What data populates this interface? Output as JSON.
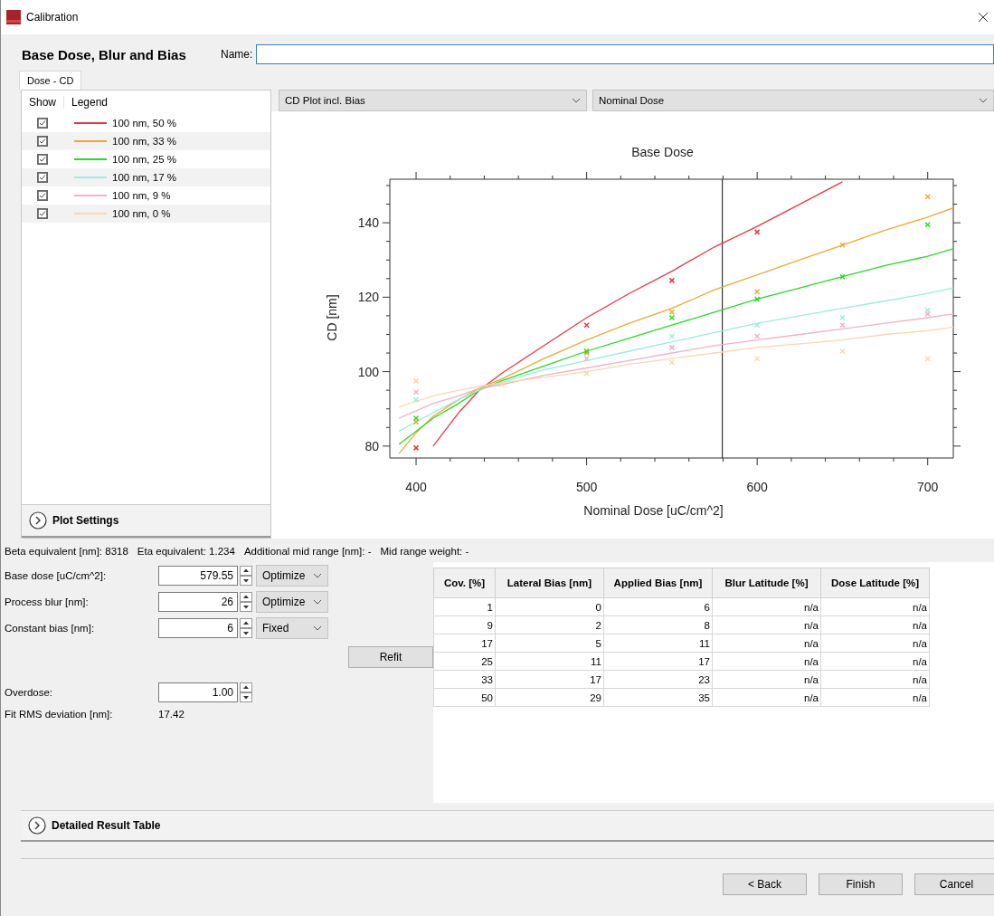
{
  "window": {
    "title": "Calibration"
  },
  "heading": "Base Dose, Blur and Bias",
  "name_field": {
    "label": "Name:"
  },
  "tabs": [
    {
      "label": "Dose - CD",
      "selected": true
    }
  ],
  "legend": {
    "columns": [
      "Show",
      "Legend"
    ],
    "items": [
      {
        "show": true,
        "label": "100 nm, 50 %",
        "color": "#ee3344"
      },
      {
        "show": true,
        "label": "100 nm, 33 %",
        "color": "#f0a830"
      },
      {
        "show": true,
        "label": "100 nm, 25 %",
        "color": "#22dd22"
      },
      {
        "show": true,
        "label": "100 nm, 17 %",
        "color": "#99eedd"
      },
      {
        "show": true,
        "label": "100 nm, 9 %",
        "color": "#f4b0c8"
      },
      {
        "show": true,
        "label": "100 nm, 0 %",
        "color": "#f8d8b0"
      }
    ]
  },
  "plot_settings": {
    "label": "Plot Settings",
    "expanded": false
  },
  "plot_type": {
    "value": "CD Plot incl. Bias"
  },
  "x_axis": {
    "value": "Nominal Dose"
  },
  "plot": {
    "fit_curves": {
      "chart_data": {
        "type": "line",
        "title": "Base Dose",
        "xlabel": "Nominal Dose [uC/cm^2]",
        "ylabel": "CD [nm]",
        "x": [
          390,
          400,
          410,
          425,
          437,
          450,
          475,
          500,
          525,
          550,
          575,
          600,
          625,
          650,
          675,
          700,
          715
        ],
        "xlim": [
          384.6,
          715
        ],
        "ylim": [
          76.8,
          151.7
        ],
        "xticks": [
          400,
          500,
          600,
          700
        ],
        "yticks": [
          80,
          100,
          120,
          140
        ],
        "series": [
          {
            "color": "#ee3344",
            "values": [
              null,
              null,
              80,
              89,
              95,
              99.5,
              107,
              114.5,
              121,
              127,
              133.5,
              139,
              145,
              151,
              null,
              null,
              null
            ]
          },
          {
            "color": "#f0a830",
            "values": [
              78,
              83.5,
              88,
              92.5,
              95.5,
              98,
              103.5,
              108.5,
              113,
              117,
              122,
              126,
              130,
              134,
              138,
              141.5,
              144
            ]
          },
          {
            "color": "#22dd22",
            "values": [
              80.5,
              84,
              87.5,
              91.5,
              95,
              97.5,
              101.5,
              105.5,
              109,
              112.5,
              116,
              119.5,
              122.5,
              125.5,
              128.5,
              131,
              133
            ]
          },
          {
            "color": "#99eedd",
            "values": [
              84,
              86.5,
              89,
              92.5,
              95,
              97,
              100.5,
              103,
              105.5,
              108,
              110.5,
              113,
              115,
              117,
              119,
              121,
              122.5
            ]
          },
          {
            "color": "#f4b0c8",
            "values": [
              87.5,
              89.5,
              91.5,
              93.5,
              95.5,
              96.5,
              99,
              101,
              103,
              105,
              107,
              108.5,
              110,
              111.5,
              113,
              114.5,
              115.5
            ]
          },
          {
            "color": "#f8d8b0",
            "values": [
              90.5,
              92,
              93.5,
              95,
              96,
              97,
              98.5,
              100,
              102,
              103.5,
              105,
              106.5,
              107.5,
              108.5,
              110,
              111,
              112
            ]
          }
        ]
      }
    },
    "measurements": {
      "chart_data": {
        "type": "scatter",
        "x": [
          400,
          450,
          500,
          550,
          600,
          650,
          700
        ],
        "xlim": [
          384.6,
          715
        ],
        "ylim": [
          76.8,
          151.7
        ],
        "series": [
          {
            "color": "#ee3344",
            "values": [
              79.5,
              null,
              112.5,
              124.5,
              137.5,
              null,
              null
            ]
          },
          {
            "color": "#f0a830",
            "values": [
              86.5,
              null,
              105,
              116,
              121.5,
              134,
              147
            ]
          },
          {
            "color": "#22dd22",
            "values": [
              87.5,
              null,
              105.5,
              114.5,
              119.5,
              125.5,
              139.5
            ]
          },
          {
            "color": "#99eedd",
            "values": [
              92.5,
              null,
              null,
              109.5,
              112.5,
              114.5,
              116.5
            ]
          },
          {
            "color": "#f4b0c8",
            "values": [
              94.5,
              null,
              103.5,
              106.5,
              109.5,
              112.5,
              115.5
            ]
          },
          {
            "color": "#f8d8b0",
            "values": [
              97.5,
              96.5,
              99.5,
              102.5,
              103.5,
              105.5,
              103.5
            ]
          }
        ]
      }
    }
  },
  "info": [
    {
      "label": "Beta equivalent [nm]:",
      "value": "8318"
    },
    {
      "label": "Eta equivalent:",
      "value": "1.234"
    },
    {
      "label": "Additional mid range [nm]:",
      "value": "-"
    },
    {
      "label": "Mid range weight:",
      "value": "-"
    }
  ],
  "fields": [
    {
      "label": "Base dose [uC/cm^2]:",
      "value": "579.55",
      "mode": "Optimize"
    },
    {
      "label": "Process blur [nm]:",
      "value": "26",
      "mode": "Optimize"
    },
    {
      "label": "Constant bias [nm]:",
      "value": "6",
      "mode": "Fixed"
    }
  ],
  "refit_button": "Refit",
  "overdose": {
    "label": "Overdose:",
    "value": "1.00"
  },
  "fit_rms": {
    "label": "Fit RMS deviation [nm]:",
    "value": "17.42"
  },
  "table": {
    "columns": [
      "Cov. [%]",
      "Lateral Bias [nm]",
      "Applied Bias [nm]",
      "Blur Latitude [%]",
      "Dose Latitude [%]"
    ],
    "rows": [
      [
        "1",
        "0",
        "6",
        "n/a",
        "n/a"
      ],
      [
        "9",
        "2",
        "8",
        "n/a",
        "n/a"
      ],
      [
        "17",
        "5",
        "11",
        "n/a",
        "n/a"
      ],
      [
        "25",
        "11",
        "17",
        "n/a",
        "n/a"
      ],
      [
        "33",
        "17",
        "23",
        "n/a",
        "n/a"
      ],
      [
        "50",
        "29",
        "35",
        "n/a",
        "n/a"
      ]
    ]
  },
  "detailed_result": {
    "label": "Detailed Result Table",
    "expanded": false
  },
  "buttons": [
    "< Back",
    "Finish",
    "Cancel"
  ]
}
